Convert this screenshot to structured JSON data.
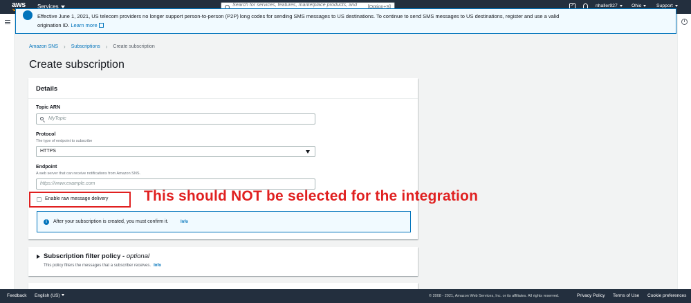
{
  "topnav": {
    "logo": "aws",
    "services_label": "Services",
    "search_placeholder": "Search for services, features, marketplace products, and docs",
    "search_shortcut": "[Option+S]",
    "user": "nhaller927",
    "region": "Ohio",
    "support": "Support"
  },
  "flash": {
    "text": "Effective June 1, 2021, US telecom providers no longer support person-to-person (P2P) long codes for sending SMS messages to US destinations. To continue to send SMS messages to US destinations, register and use a valid origination ID.",
    "link": "Learn more",
    "color": "#0073bb"
  },
  "breadcrumb": [
    "Amazon SNS",
    "Subscriptions",
    "Create subscription"
  ],
  "page_title": "Create subscription",
  "details": {
    "title": "Details",
    "topic_arn": {
      "label": "Topic ARN",
      "placeholder": "MyTopic"
    },
    "protocol": {
      "label": "Protocol",
      "description": "The type of endpoint to subscribe",
      "value": "HTTPS"
    },
    "endpoint": {
      "label": "Endpoint",
      "description": "A web server that can receive notifications from Amazon SNS.",
      "placeholder": "https://www.example.com"
    },
    "raw_delivery": {
      "label": "Enable raw message delivery",
      "checked": false
    },
    "alert": {
      "text": "After your subscription is created, you must confirm it.",
      "info": "Info"
    }
  },
  "annotation": {
    "text": "This should NOT be selected for the integration",
    "color": "#e02020"
  },
  "filter_policy": {
    "title": "Subscription filter policy - ",
    "title_optional": "optional",
    "description": "This policy filters the messages that a subscriber receives.",
    "info": "Info"
  },
  "footer": {
    "feedback": "Feedback",
    "language": "English (US)",
    "copyright": "© 2008 - 2021, Amazon Web Services, Inc. or its affiliates. All rights reserved.",
    "privacy": "Privacy Policy",
    "terms": "Terms of Use",
    "cookies": "Cookie preferences"
  }
}
